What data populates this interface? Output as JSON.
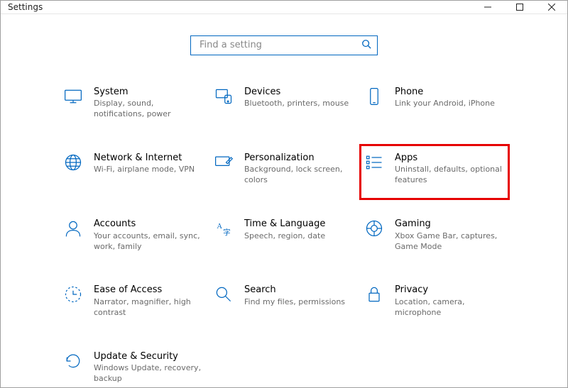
{
  "window": {
    "title": "Settings"
  },
  "search": {
    "placeholder": "Find a setting"
  },
  "tiles": [
    {
      "title": "System",
      "subtitle": "Display, sound, notifications, power"
    },
    {
      "title": "Devices",
      "subtitle": "Bluetooth, printers, mouse"
    },
    {
      "title": "Phone",
      "subtitle": "Link your Android, iPhone"
    },
    {
      "title": "Network & Internet",
      "subtitle": "Wi-Fi, airplane mode, VPN"
    },
    {
      "title": "Personalization",
      "subtitle": "Background, lock screen, colors"
    },
    {
      "title": "Apps",
      "subtitle": "Uninstall, defaults, optional features"
    },
    {
      "title": "Accounts",
      "subtitle": "Your accounts, email, sync, work, family"
    },
    {
      "title": "Time & Language",
      "subtitle": "Speech, region, date"
    },
    {
      "title": "Gaming",
      "subtitle": "Xbox Game Bar, captures, Game Mode"
    },
    {
      "title": "Ease of Access",
      "subtitle": "Narrator, magnifier, high contrast"
    },
    {
      "title": "Search",
      "subtitle": "Find my files, permissions"
    },
    {
      "title": "Privacy",
      "subtitle": "Location, camera, microphone"
    },
    {
      "title": "Update & Security",
      "subtitle": "Windows Update, recovery, backup"
    }
  ]
}
